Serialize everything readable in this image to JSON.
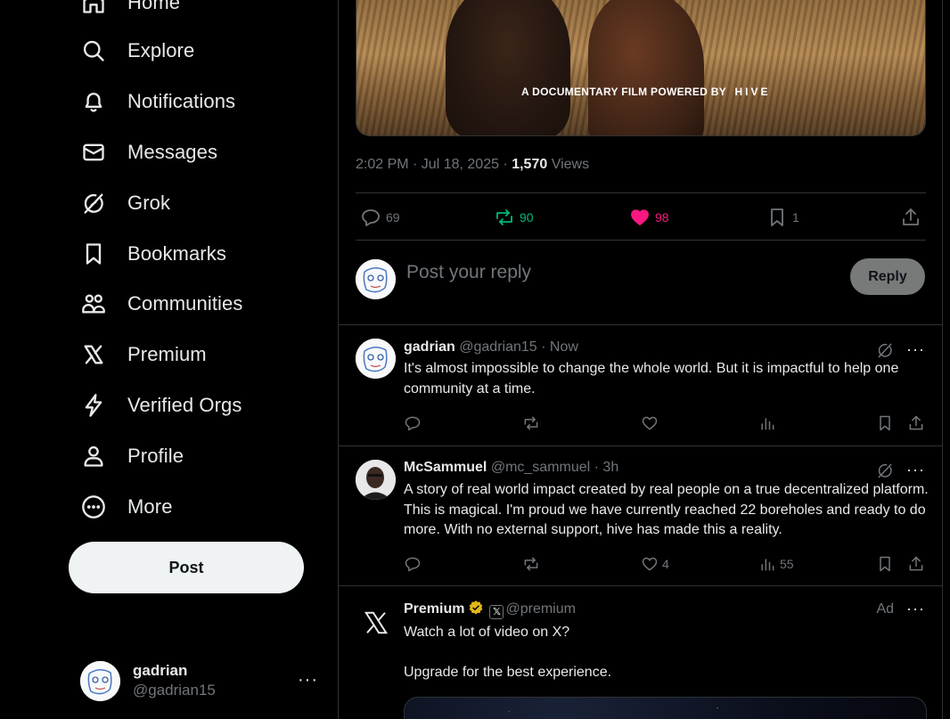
{
  "nav": {
    "items": [
      {
        "label": "Home",
        "icon": "home-icon"
      },
      {
        "label": "Explore",
        "icon": "search-icon"
      },
      {
        "label": "Notifications",
        "icon": "bell-icon"
      },
      {
        "label": "Messages",
        "icon": "envelope-icon"
      },
      {
        "label": "Grok",
        "icon": "grok-icon"
      },
      {
        "label": "Bookmarks",
        "icon": "bookmark-icon"
      },
      {
        "label": "Communities",
        "icon": "communities-icon"
      },
      {
        "label": "Premium",
        "icon": "x-logo-icon"
      },
      {
        "label": "Verified Orgs",
        "icon": "lightning-icon"
      },
      {
        "label": "Profile",
        "icon": "person-icon"
      },
      {
        "label": "More",
        "icon": "more-circle-icon"
      }
    ],
    "post_button": "Post"
  },
  "account": {
    "name": "gadrian",
    "handle": "@gadrian15",
    "more": "···"
  },
  "media": {
    "caption": "A DOCUMENTARY FILM POWERED BY",
    "brand": "HIVE"
  },
  "tweet_meta": {
    "time": "2:02 PM · Jul 18, 2025 · ",
    "views_count": "1,570",
    "views_label": " Views"
  },
  "actions": {
    "replies": "69",
    "reposts": "90",
    "likes": "98",
    "bookmarks": "1",
    "colors": {
      "repost": "#00ba7c",
      "like": "#f91880",
      "muted": "#71767b"
    }
  },
  "reply_box": {
    "placeholder": "Post your reply",
    "button": "Reply"
  },
  "replies": [
    {
      "name": "gadrian",
      "handle": "@gadrian15",
      "time": " · Now",
      "text": "It's almost impossible to change the whole world. But it is impactful to help one community at a time.",
      "likes": "",
      "views": ""
    },
    {
      "name": "McSammuel",
      "handle": "@mc_sammuel",
      "time": " · 3h",
      "text": "A story of real world impact created by real people on a true decentralized platform. This is magical. I'm proud we have currently reached 22 boreholes and ready to do more. With no external support, hive has made this a reality.",
      "likes": "4",
      "views": "55"
    }
  ],
  "ad": {
    "name": "Premium",
    "handle": "@premium",
    "x_badge": "𝕏",
    "label": "Ad",
    "line1": "Watch a lot of video on X?",
    "line2": "Upgrade for the best experience."
  }
}
